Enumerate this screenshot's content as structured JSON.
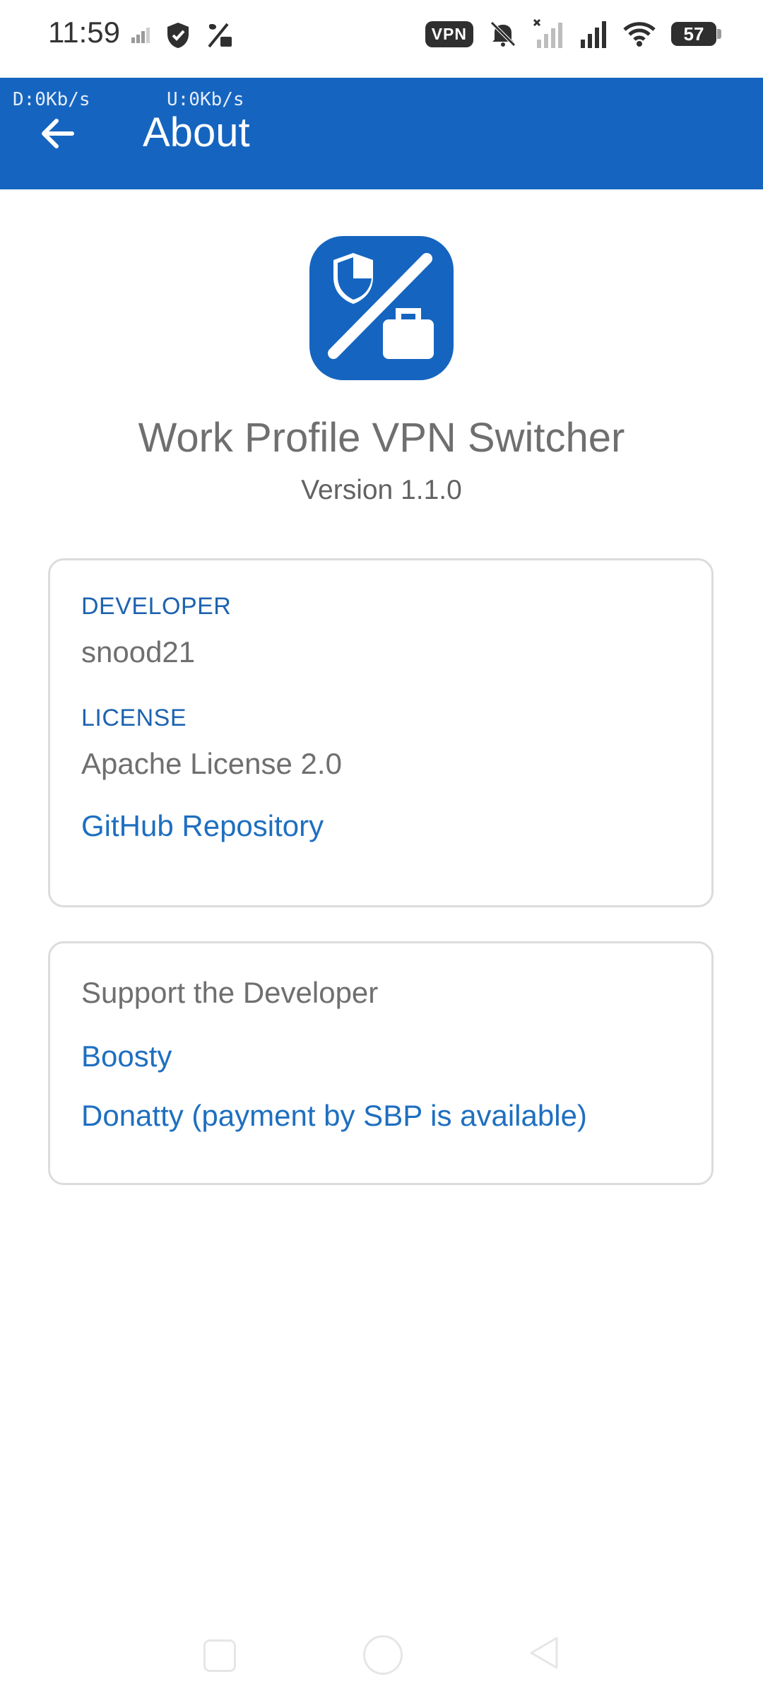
{
  "status_bar": {
    "time": "11:59",
    "vpn_label": "VPN",
    "battery_level": "57",
    "icons": [
      "signal-small-icon",
      "shield-icon",
      "work-off-icon",
      "mute-icon",
      "no-signal-icon",
      "signal-icon",
      "wifi-icon",
      "battery-icon"
    ]
  },
  "app_bar": {
    "net_down": "D:0Kb/s",
    "net_up": "U:0Kb/s",
    "title": "About"
  },
  "app": {
    "name": "Work Profile VPN Switcher",
    "version": "Version 1.1.0",
    "icon_color": "#1565c0"
  },
  "info_card": {
    "developer_label": "DEVELOPER",
    "developer_value": "snood21",
    "license_label": "LICENSE",
    "license_value": "Apache License 2.0",
    "github_link": "GitHub Repository"
  },
  "support_card": {
    "title": "Support the Developer",
    "links": [
      "Boosty",
      "Donatty (payment by SBP is available)"
    ]
  },
  "colors": {
    "primary": "#1565c0",
    "link": "#1e6fc0",
    "label": "#1e63b0"
  }
}
